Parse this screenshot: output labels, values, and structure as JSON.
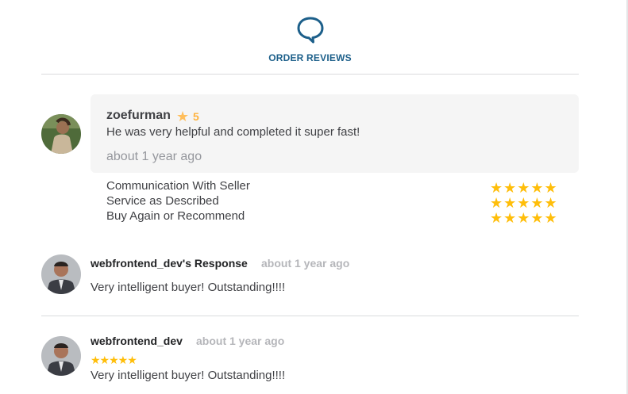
{
  "header": {
    "title": "ORDER REVIEWS",
    "icon": "chat-bubble-icon",
    "accent": "#1c5f8a"
  },
  "review": {
    "username": "zoefurman",
    "rating": "5",
    "text": "He was very helpful and completed it super fast!",
    "time": "about 1 year ago",
    "criteria": [
      {
        "label": "Communication With Seller",
        "stars": 5
      },
      {
        "label": "Service as Described",
        "stars": 5
      },
      {
        "label": "Buy Again or Recommend",
        "stars": 5
      }
    ]
  },
  "seller_response": {
    "name": "webfrontend_dev's Response",
    "time": "about 1 year ago",
    "text": "Very intelligent buyer! Outstanding!!!!"
  },
  "seller_review": {
    "name": "webfrontend_dev",
    "time": "about 1 year ago",
    "stars": 5,
    "text": "Very intelligent buyer! Outstanding!!!!"
  },
  "colors": {
    "star": "#ffbe0a",
    "muted_text": "#95979d",
    "box_bg": "#f5f5f5"
  }
}
